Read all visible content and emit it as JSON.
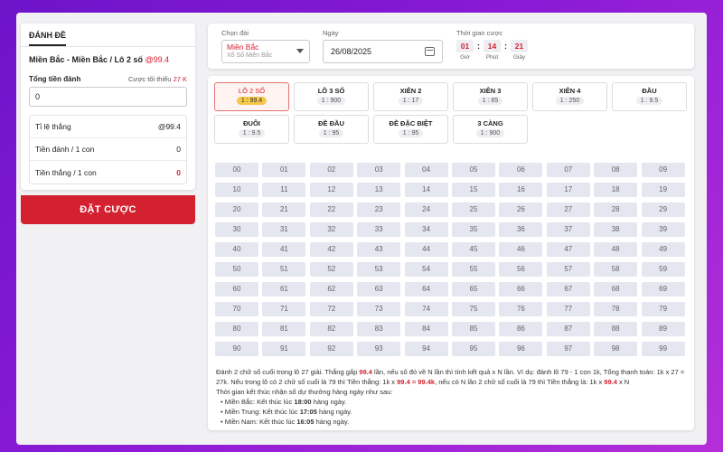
{
  "bet_panel": {
    "tab": "ĐÁNH ĐỀ",
    "title_prefix": "Miền Bắc - Miền Bắc / Lô 2 số ",
    "title_rate": "@99.4",
    "amount_label": "Tổng tiền đánh",
    "min_bet_label": "Cược tối thiểu ",
    "min_bet_value": "27 K",
    "amount_value": "0",
    "stats": [
      {
        "label": "Tỉ lệ thắng",
        "value": "@99.4"
      },
      {
        "label": "Tiền đánh / 1 con",
        "value": "0"
      },
      {
        "label": "Tiền thắng / 1 con",
        "value": "0"
      }
    ],
    "submit_label": "ĐẶT CƯỢC"
  },
  "topbar": {
    "region_label": "Chọn đài",
    "region_name": "Miền Bắc",
    "region_sub": "Xổ Số Miền Bắc",
    "date_label": "Ngày",
    "date_value": "26/08/2025",
    "time_label": "Thời gian cược",
    "hours": "01",
    "minutes": "14",
    "seconds": "21",
    "hours_label": "Giờ",
    "minutes_label": "Phút",
    "seconds_label": "Giây"
  },
  "bet_types": [
    {
      "name": "LÔ 2 SỐ",
      "rate": "1 : 99.4",
      "active": true
    },
    {
      "name": "LÔ 3 SỐ",
      "rate": "1 : 900"
    },
    {
      "name": "XIÊN 2",
      "rate": "1 : 17"
    },
    {
      "name": "XIÊN 3",
      "rate": "1 : 65"
    },
    {
      "name": "XIÊN 4",
      "rate": "1 : 250"
    },
    {
      "name": "ĐẦU",
      "rate": "1 : 9.5"
    },
    {
      "name": "ĐUÔI",
      "rate": "1 : 9.5"
    },
    {
      "name": "ĐỀ ĐẦU",
      "rate": "1 : 95"
    },
    {
      "name": "ĐỀ ĐẶC BIỆT",
      "rate": "1 : 95"
    },
    {
      "name": "3 CÀNG",
      "rate": "1 : 900"
    }
  ],
  "numbers": [
    "00",
    "01",
    "02",
    "03",
    "04",
    "05",
    "06",
    "07",
    "08",
    "09",
    "10",
    "11",
    "12",
    "13",
    "14",
    "15",
    "16",
    "17",
    "18",
    "19",
    "20",
    "21",
    "22",
    "23",
    "24",
    "25",
    "26",
    "27",
    "28",
    "29",
    "30",
    "31",
    "32",
    "33",
    "34",
    "35",
    "36",
    "37",
    "38",
    "39",
    "40",
    "41",
    "42",
    "43",
    "44",
    "45",
    "46",
    "47",
    "48",
    "49",
    "50",
    "51",
    "52",
    "53",
    "54",
    "55",
    "56",
    "57",
    "58",
    "59",
    "60",
    "61",
    "62",
    "63",
    "64",
    "65",
    "66",
    "67",
    "68",
    "69",
    "70",
    "71",
    "72",
    "73",
    "74",
    "75",
    "76",
    "77",
    "78",
    "79",
    "80",
    "81",
    "82",
    "83",
    "84",
    "85",
    "86",
    "87",
    "88",
    "89",
    "90",
    "91",
    "92",
    "93",
    "94",
    "95",
    "96",
    "97",
    "98",
    "99"
  ],
  "description": {
    "p1_a": "Đánh 2 chữ số cuối trong lô 27 giải. Thắng gấp ",
    "p1_rate": "99.4",
    "p1_b": " lần, nếu số đó về N lần thì tính kết quả x N lần. Ví dụ: đánh lô 79 - 1 con 1k, Tổng thanh toán: 1k x 27 = 27k. Nếu trong lô có 2 chữ số cuối là 79 thì Tiền thắng: 1k x ",
    "p1_calc": "99.4 = 99.4k",
    "p1_c": ", nếu có N lần 2 chữ số cuối là 79 thì Tiền thắng là: 1k x ",
    "p1_rate2": "99.4",
    "p1_d": " x N",
    "p2": "Thời gian kết thúc nhận số dự thưởng hàng ngày như sau:",
    "schedule": [
      {
        "region": "Miền Bắc: Kết thúc lúc ",
        "time": "18:00",
        "suffix": " hàng ngày."
      },
      {
        "region": "Miền Trung: Kết thúc lúc ",
        "time": "17:05",
        "suffix": " hàng ngày."
      },
      {
        "region": "Miền Nam: Kết thúc lúc ",
        "time": "16:05",
        "suffix": " hàng ngày."
      }
    ]
  }
}
